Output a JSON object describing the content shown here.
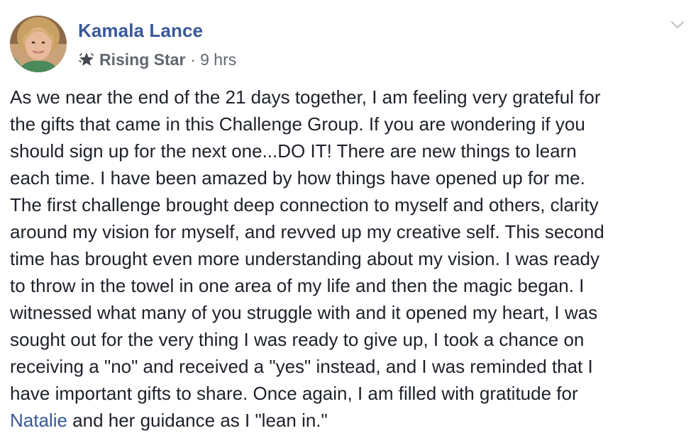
{
  "post": {
    "author": "Kamala Lance",
    "badge": "Rising Star",
    "separator": "·",
    "time": "9 hrs",
    "menu_icon": "chevron-down-icon",
    "badge_icon": "star-badge-icon",
    "lines": [
      "As we near the end of the 21 days together, I am feeling very grateful for",
      "the gifts that came in this Challenge Group. If you are wondering if you",
      "should sign up for the next one...DO IT! There are new things to learn",
      "each time. I have been amazed by how things have opened up for me.",
      "The first challenge brought deep connection to myself and others, clarity",
      "around my vision for myself, and revved up my creative self. This second",
      "time has brought even more understanding about my vision. I was ready",
      "to throw in the towel in one area of my life and then the magic began. I",
      "witnessed what many of you struggle with and it opened my heart, I was",
      "sought out for the very thing I was ready to give up, I took a chance on",
      "receiving a \"no\" and received a \"yes\" instead, and I was reminded that I",
      "have important gifts to share. Once again, I am filled with gratitude for"
    ],
    "mention": "Natalie",
    "last_line_rest": " and her guidance as I \"lean in.\""
  },
  "colors": {
    "link": "#385898",
    "text": "#1d2129",
    "meta": "#606770"
  }
}
